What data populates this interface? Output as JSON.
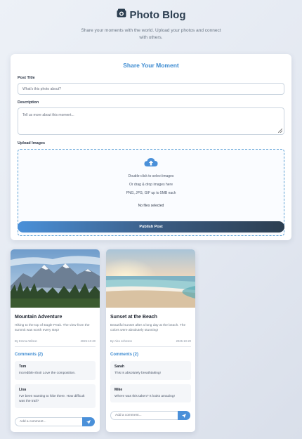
{
  "header": {
    "title": "Photo Blog",
    "subtitle": "Share your moments with the world. Upload your photos and connect with others."
  },
  "form": {
    "heading": "Share Your Moment",
    "title_label": "Post Title",
    "title_placeholder": "What's this photo about?",
    "description_label": "Description",
    "description_placeholder": "Tell us more about this moment...",
    "upload_label": "Upload Images",
    "upload_line1": "Double-click to select images",
    "upload_line2": "Or drag & drop images here",
    "upload_line3": "PNG, JPG, GIF up to 5MB each",
    "upload_status": "No files selected",
    "publish_label": "Publish Post"
  },
  "posts": [
    {
      "title": "Mountain Adventure",
      "description": "Hiking to the top of Eagle Peak. The view from the summit was worth every step!",
      "author": "By Emma Wilson",
      "date": "2025-10-20",
      "comments_heading": "Comments (2)",
      "comments": [
        {
          "author": "Tom",
          "text": "Incredible shot! Love the composition."
        },
        {
          "author": "Lisa",
          "text": "I've been wanting to hike there. How difficult was the trail?"
        }
      ],
      "comment_placeholder": "Add a comment..."
    },
    {
      "title": "Sunset at the Beach",
      "description": "Beautiful sunset after a long day at the beach. The colors were absolutely stunning!",
      "author": "By Alex Johnson",
      "date": "2025-10-20",
      "comments_heading": "Comments (2)",
      "comments": [
        {
          "author": "Sarah",
          "text": "This is absolutely breathtaking!"
        },
        {
          "author": "Mike",
          "text": "Where was this taken? It looks amazing!"
        }
      ],
      "comment_placeholder": "Add a comment..."
    }
  ],
  "colors": {
    "accent": "#3d8bd1",
    "title": "#2c3e50",
    "button_end": "#2c3e50"
  },
  "icons": {
    "logo": "camera-icon",
    "upload": "cloud-upload-icon",
    "send": "send-icon"
  }
}
